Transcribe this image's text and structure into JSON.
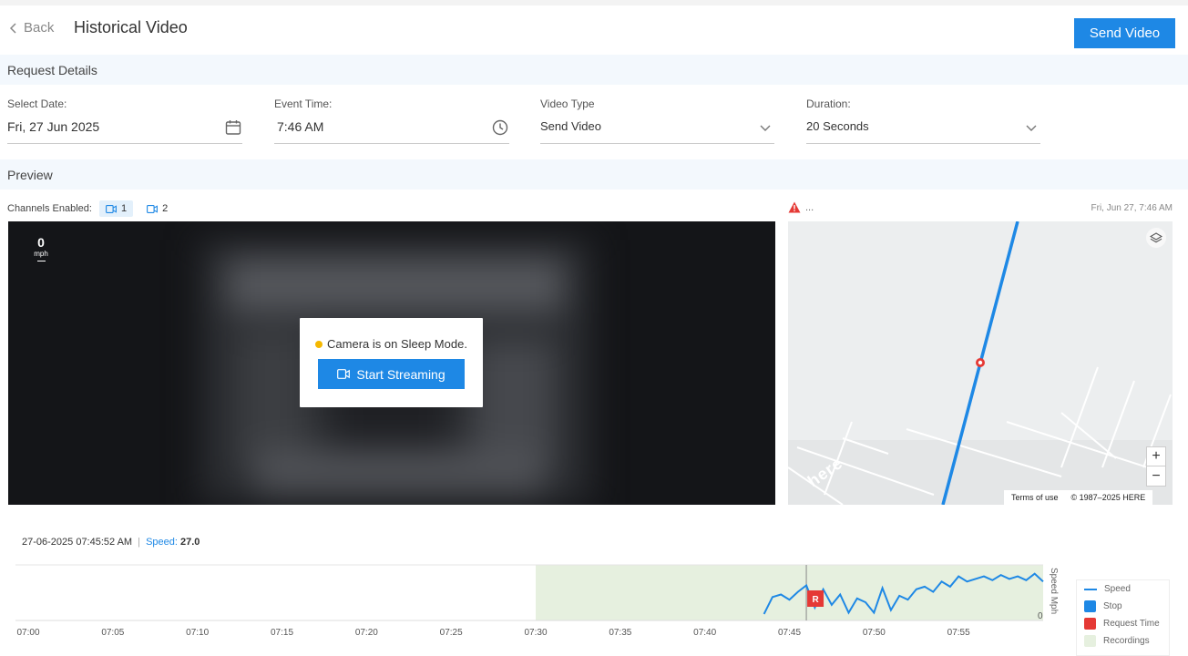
{
  "header": {
    "back_label": "Back",
    "title": "Historical Video",
    "send_button": "Send Video"
  },
  "sections": {
    "request_details": "Request Details",
    "preview": "Preview"
  },
  "form": {
    "date": {
      "label": "Select Date:",
      "value": "Fri, 27 Jun 2025",
      "icon": "calendar-icon"
    },
    "event_time": {
      "label": "Event Time:",
      "value": "7:46 AM",
      "icon": "clock-icon"
    },
    "video_type": {
      "label": "Video Type",
      "value": "Send Video",
      "icon": "chevron-down-icon"
    },
    "duration": {
      "label": "Duration:",
      "value": "20 Seconds",
      "icon": "chevron-down-icon"
    }
  },
  "channels": {
    "label": "Channels Enabled:",
    "items": [
      {
        "label": "1",
        "active": true
      },
      {
        "label": "2",
        "active": false
      }
    ]
  },
  "video": {
    "speed_value": "0",
    "speed_unit": "mph",
    "sleep_message": "Camera is on Sleep Mode.",
    "stream_button": "Start Streaming",
    "status_color": "#f5b800"
  },
  "map": {
    "alert_text": "...",
    "timestamp": "Fri, Jun 27, 7:46 AM",
    "terms": "Terms of use",
    "copyright": "© 1987–2025 HERE",
    "logo": "here",
    "zoom_in": "+",
    "zoom_out": "−"
  },
  "timeline": {
    "datetime": "27-06-2025 07:45:52 AM",
    "separator": "|",
    "speed_label": "Speed:",
    "speed_value": "27.0"
  },
  "chart_data": {
    "type": "line",
    "x_ticks": [
      "07:00",
      "07:05",
      "07:10",
      "07:15",
      "07:20",
      "07:25",
      "07:30",
      "07:35",
      "07:40",
      "07:45",
      "07:50",
      "07:55"
    ],
    "ylabel": "Speed Mph",
    "y_min_label": "0",
    "ylim": [
      0,
      40
    ],
    "recordings_range_min": [
      30,
      60
    ],
    "request_time_min": 46,
    "request_marker": "R",
    "speed_series": {
      "name": "Speed",
      "x_min": [
        43.5,
        44,
        44.5,
        45,
        45.5,
        46,
        46.5,
        47,
        47.5,
        48,
        48.5,
        49,
        49.5,
        50,
        50.5,
        51,
        51.5,
        52,
        52.5,
        53,
        53.5,
        54,
        54.5,
        55,
        55.5,
        56,
        56.5,
        57,
        57.5,
        58,
        58.5,
        59,
        59.5,
        60
      ],
      "y": [
        5,
        18,
        20,
        16,
        22,
        27,
        10,
        24,
        12,
        20,
        6,
        17,
        14,
        6,
        25,
        8,
        19,
        16,
        24,
        26,
        22,
        30,
        26,
        34,
        30,
        32,
        34,
        31,
        35,
        32,
        34,
        31,
        36,
        30
      ]
    },
    "legend": [
      {
        "name": "Speed",
        "color": "#1e88e5",
        "kind": "line"
      },
      {
        "name": "Stop",
        "color": "#1e88e5",
        "kind": "box"
      },
      {
        "name": "Request Time",
        "color": "#e53935",
        "kind": "box"
      },
      {
        "name": "Recordings",
        "color": "#e6f0df",
        "kind": "box"
      }
    ]
  }
}
